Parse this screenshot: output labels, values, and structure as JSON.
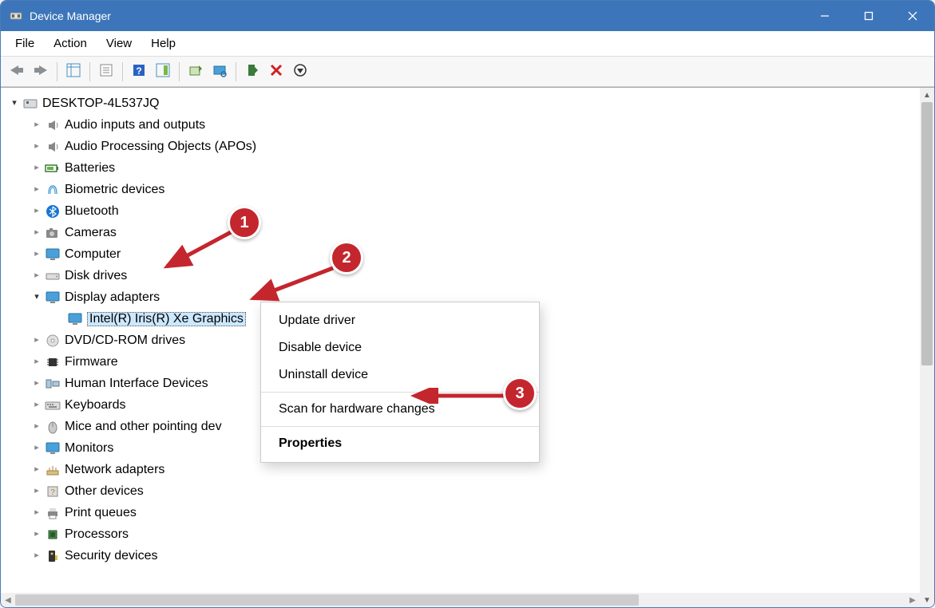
{
  "title": "Device Manager",
  "menubar": [
    "File",
    "Action",
    "View",
    "Help"
  ],
  "tree": {
    "root": "DESKTOP-4L537JQ",
    "items": [
      {
        "label": "Audio inputs and outputs",
        "icon": "speaker"
      },
      {
        "label": "Audio Processing Objects (APOs)",
        "icon": "speaker"
      },
      {
        "label": "Batteries",
        "icon": "battery"
      },
      {
        "label": "Biometric devices",
        "icon": "fingerprint"
      },
      {
        "label": "Bluetooth",
        "icon": "bluetooth"
      },
      {
        "label": "Cameras",
        "icon": "camera"
      },
      {
        "label": "Computer",
        "icon": "monitor"
      },
      {
        "label": "Disk drives",
        "icon": "drive"
      },
      {
        "label": "Display adapters",
        "icon": "monitor",
        "expanded": true,
        "children": [
          {
            "label": "Intel(R) Iris(R) Xe Graphics",
            "icon": "monitor",
            "selected": true
          }
        ]
      },
      {
        "label": "DVD/CD-ROM drives",
        "icon": "disc"
      },
      {
        "label": "Firmware",
        "icon": "chip"
      },
      {
        "label": "Human Interface Devices",
        "icon": "hid"
      },
      {
        "label": "Keyboards",
        "icon": "keyboard"
      },
      {
        "label": "Mice and other pointing dev",
        "icon": "mouse",
        "truncated": true
      },
      {
        "label": "Monitors",
        "icon": "monitor"
      },
      {
        "label": "Network adapters",
        "icon": "network"
      },
      {
        "label": "Other devices",
        "icon": "other"
      },
      {
        "label": "Print queues",
        "icon": "printer"
      },
      {
        "label": "Processors",
        "icon": "cpu"
      },
      {
        "label": "Security devices",
        "icon": "security"
      }
    ]
  },
  "context_menu": {
    "items": [
      {
        "label": "Update driver"
      },
      {
        "label": "Disable device"
      },
      {
        "label": "Uninstall device"
      },
      {
        "sep": true
      },
      {
        "label": "Scan for hardware changes"
      },
      {
        "sep": true
      },
      {
        "label": "Properties",
        "bold": true
      }
    ]
  },
  "annotations": {
    "c1": "1",
    "c2": "2",
    "c3": "3"
  }
}
